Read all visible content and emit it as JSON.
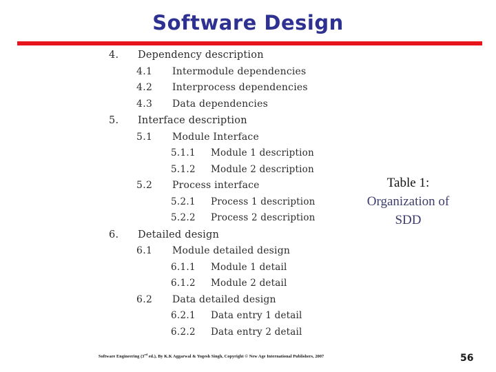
{
  "slide": {
    "title": "Software Design",
    "title_color": "#2E3192",
    "rule_color": "#E8141B"
  },
  "toc": {
    "items": [
      {
        "level": 1,
        "num": "4.",
        "text": "Dependency description"
      },
      {
        "level": 2,
        "num": "4.1",
        "text": "Intermodule dependencies"
      },
      {
        "level": 2,
        "num": "4.2",
        "text": "Interprocess dependencies"
      },
      {
        "level": 2,
        "num": "4.3",
        "text": "Data dependencies"
      },
      {
        "level": 1,
        "num": "5.",
        "text": "Interface description"
      },
      {
        "level": 2,
        "num": "5.1",
        "text": "Module Interface"
      },
      {
        "level": 3,
        "num": "5.1.1",
        "text": "Module 1 description"
      },
      {
        "level": 3,
        "num": "5.1.2",
        "text": "Module 2 description"
      },
      {
        "level": 2,
        "num": "5.2",
        "text": "Process interface"
      },
      {
        "level": 3,
        "num": "5.2.1",
        "text": "Process 1 description"
      },
      {
        "level": 3,
        "num": "5.2.2",
        "text": "Process 2 description"
      },
      {
        "level": 1,
        "num": "6.",
        "text": "Detailed design"
      },
      {
        "level": 2,
        "num": "6.1",
        "text": "Module detailed design"
      },
      {
        "level": 3,
        "num": "6.1.1",
        "text": "Module 1 detail"
      },
      {
        "level": 3,
        "num": "6.1.2",
        "text": "Module 2 detail"
      },
      {
        "level": 2,
        "num": "6.2",
        "text": "Data detailed design"
      },
      {
        "level": 3,
        "num": "6.2.1",
        "text": "Data entry 1 detail"
      },
      {
        "level": 3,
        "num": "6.2.2",
        "text": "Data entry 2 detail"
      }
    ]
  },
  "caption": {
    "line1": "Table 1:",
    "line2": "Organization of",
    "line3": "SDD",
    "line1_color": "#111111",
    "line2_color": "#3c3c6e"
  },
  "footer": {
    "credit_prefix": "Software Engineering (3",
    "credit_sup": "rd",
    "credit_suffix": " ed.), By K.K Aggarwal & Yogesh Singh, Copyright © New Age International Publishers, 2007",
    "page_number": "56"
  }
}
